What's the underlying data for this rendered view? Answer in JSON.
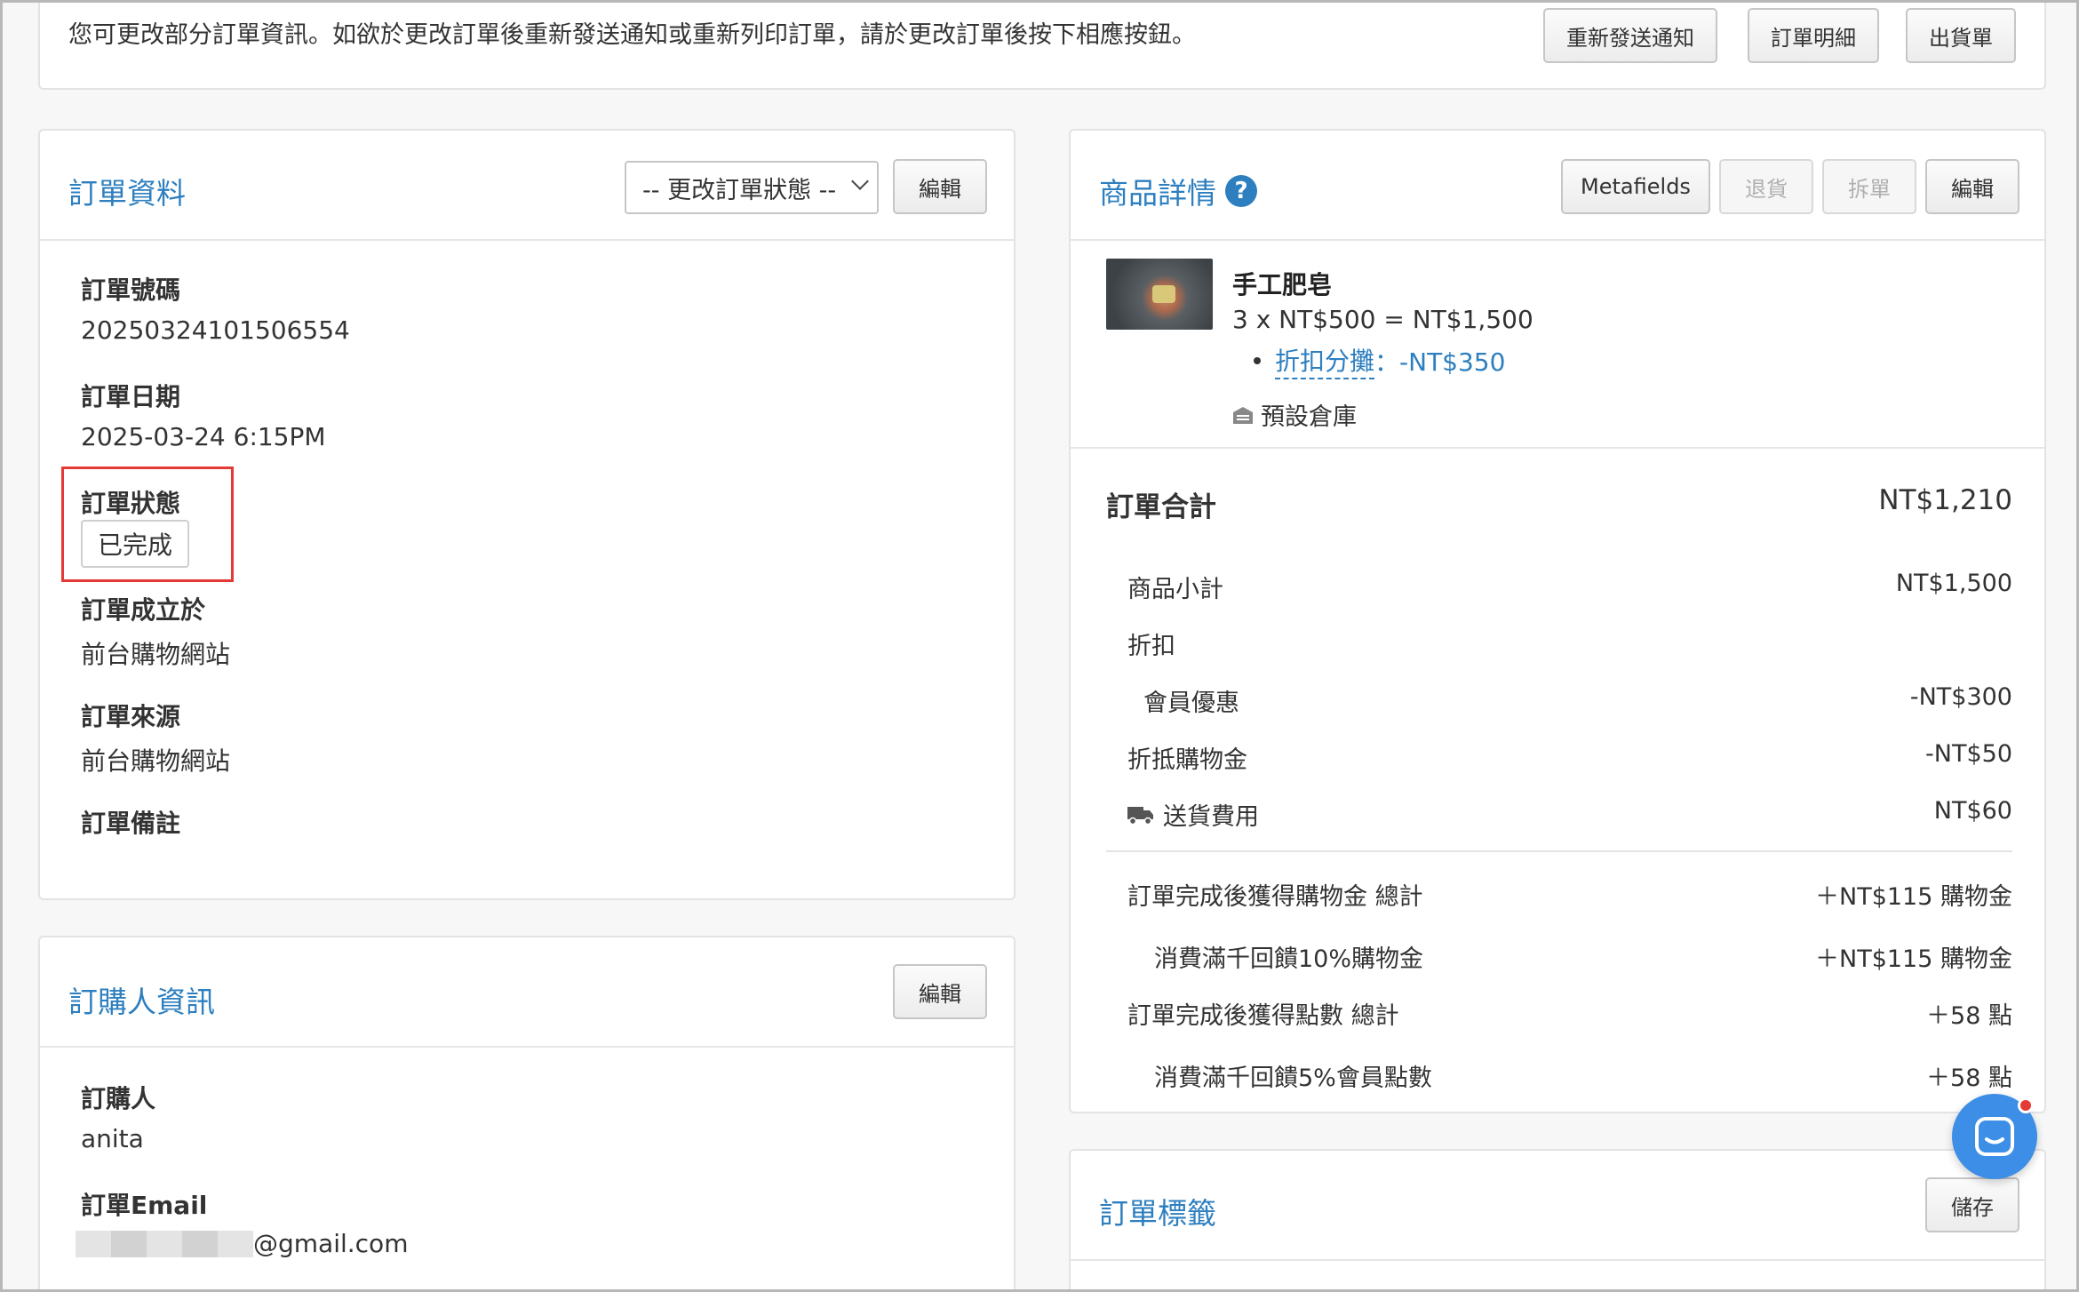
{
  "notice": {
    "text": "您可更改部分訂單資訊。如欲於更改訂單後重新發送通知或重新列印訂單，請於更改訂單後按下相應按鈕。",
    "buttons": [
      "重新發送通知",
      "訂單明細",
      "出貨單"
    ]
  },
  "order_info": {
    "title": "訂單資料",
    "status_select": "-- 更改訂單狀態 --",
    "edit_label": "編輯",
    "fields": [
      {
        "label": "訂單號碼",
        "value": "20250324101506554"
      },
      {
        "label": "訂單日期",
        "value": "2025-03-24 6:15PM"
      },
      {
        "label": "訂單狀態",
        "value": "已完成"
      },
      {
        "label": "訂單成立於",
        "value": "前台購物網站"
      },
      {
        "label": "訂單來源",
        "value": "前台購物網站"
      },
      {
        "label": "訂單備註",
        "value": ""
      }
    ]
  },
  "buyer_info": {
    "title": "訂購人資訊",
    "edit_label": "編輯",
    "buyer_label": "訂購人",
    "buyer_name": "anita",
    "email_label": "訂單Email",
    "email_suffix": "@gmail.com"
  },
  "product": {
    "title": "商品詳情",
    "help_icon": "?",
    "buttons": {
      "metafields": "Metafields",
      "return": "退貨",
      "split": "拆單",
      "edit": "編輯"
    },
    "item": {
      "name": "手工肥皂",
      "qty_line": "3 x NT$500 = NT$1,500",
      "discount_label": "折扣分攤",
      "discount_value": "：-NT$350",
      "warehouse": "預設倉庫"
    }
  },
  "totals": {
    "title": "訂單合計",
    "total": "NT$1,210",
    "rows": [
      {
        "label": "商品小計",
        "value": "NT$1,500"
      },
      {
        "label": "折扣",
        "value": ""
      },
      {
        "label": "會員優惠",
        "value": "-NT$300"
      },
      {
        "label": "折抵購物金",
        "value": "-NT$50"
      },
      {
        "label": "送貨費用",
        "value": "NT$60"
      }
    ],
    "rewards": [
      {
        "label": "訂單完成後獲得購物金 總計",
        "value": "＋NT$115 購物金"
      },
      {
        "label": "消費滿千回饋10%購物金",
        "value": "＋NT$115 購物金"
      },
      {
        "label": "訂單完成後獲得點數 總計",
        "value": "＋58 點"
      },
      {
        "label": "消費滿千回饋5%會員點數",
        "value": "＋58 點"
      }
    ]
  },
  "tags": {
    "title": "訂單標籤",
    "save_label": "儲存"
  },
  "colors": {
    "accent": "#2d7fbf",
    "highlight": "#e53935",
    "chat": "#3d8ee6"
  }
}
